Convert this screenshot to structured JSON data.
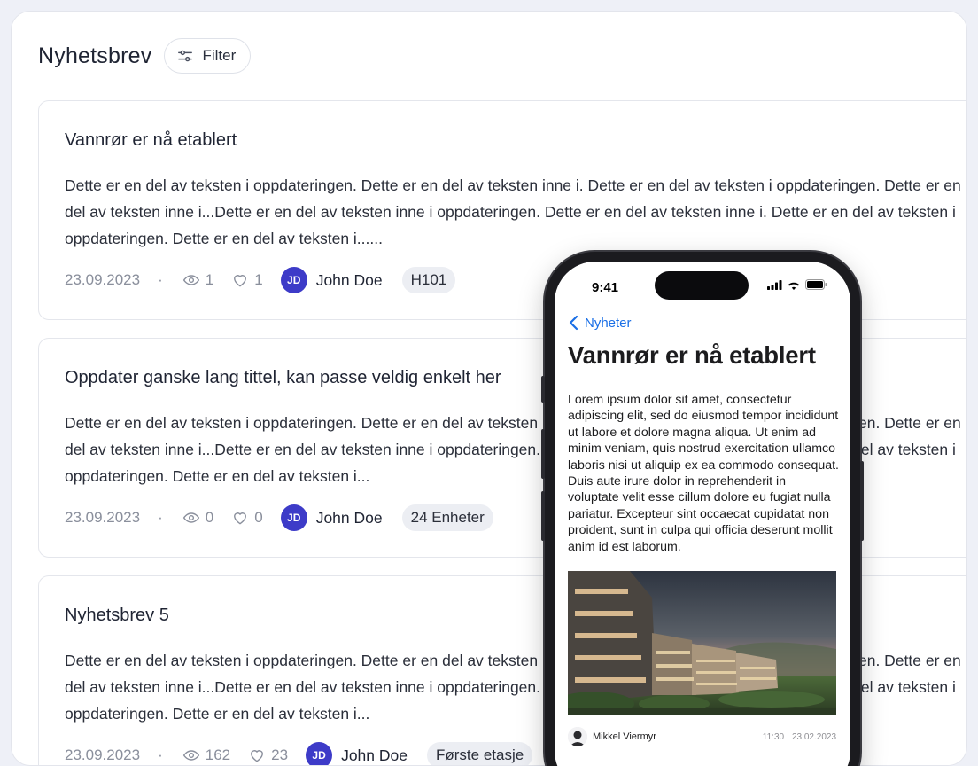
{
  "header": {
    "title": "Nyhetsbrev",
    "filter_label": "Filter"
  },
  "posts": [
    {
      "title": "Vannrør er nå etablert",
      "body": "Dette er en del av teksten i oppdateringen. Dette er en del av teksten inne i. Dette er en del av teksten i oppdateringen. Dette er en del av teksten inne i...Dette er en del av teksten inne i oppdateringen. Dette er en del av teksten inne i. Dette er en del av teksten i oppdateringen. Dette er en del av teksten i......",
      "date": "23.09.2023",
      "views": "1",
      "likes": "1",
      "author_initials": "JD",
      "author": "John Doe",
      "tag": "H101"
    },
    {
      "title": "Oppdater ganske lang tittel, kan passe veldig enkelt her",
      "body": "Dette er en del av teksten i oppdateringen. Dette er en del av teksten inne i. Dette er en del av teksten i oppdateringen. Dette er en del av teksten inne i...Dette er en del av teksten inne i oppdateringen. Dette er en del av teksten inne i. Dette er en del av teksten i oppdateringen. Dette er en del av teksten i...",
      "date": "23.09.2023",
      "views": "0",
      "likes": "0",
      "author_initials": "JD",
      "author": "John Doe",
      "tag": "24 Enheter"
    },
    {
      "title": "Nyhetsbrev 5",
      "body": "Dette er en del av teksten i oppdateringen. Dette er en del av teksten inne i. Dette er en del av teksten i oppdateringen. Dette er en del av teksten inne i...Dette er en del av teksten inne i oppdateringen. Dette er en del av teksten inne i. Dette er en del av teksten i oppdateringen. Dette er en del av teksten i...",
      "date": "23.09.2023",
      "views": "162",
      "likes": "23",
      "author_initials": "JD",
      "author": "John Doe",
      "tag": "Første etasje"
    }
  ],
  "separator": "·",
  "phone": {
    "time": "9:41",
    "back_label": "Nyheter",
    "article_title": "Vannrør er nå etablert",
    "article_body": "Lorem ipsum dolor sit amet, consectetur adipiscing elit, sed do eiusmod tempor incididunt ut labore et dolore magna aliqua. Ut enim ad minim veniam, quis nostrud exercitation ullamco laboris nisi ut aliquip ex ea commodo consequat. Duis aute irure dolor in reprehenderit in voluptate velit esse cillum dolore eu fugiat nulla pariatur. Excepteur sint occaecat cupidatat non proident, sunt in culpa qui officia deserunt mollit anim id est laborum.",
    "author": "Mikkel Viermyr",
    "timestamp": "11:30 · 23.02.2023"
  },
  "colors": {
    "accent": "#3d3bc8",
    "link": "#1a6fe6",
    "muted": "#8a8f9c"
  }
}
